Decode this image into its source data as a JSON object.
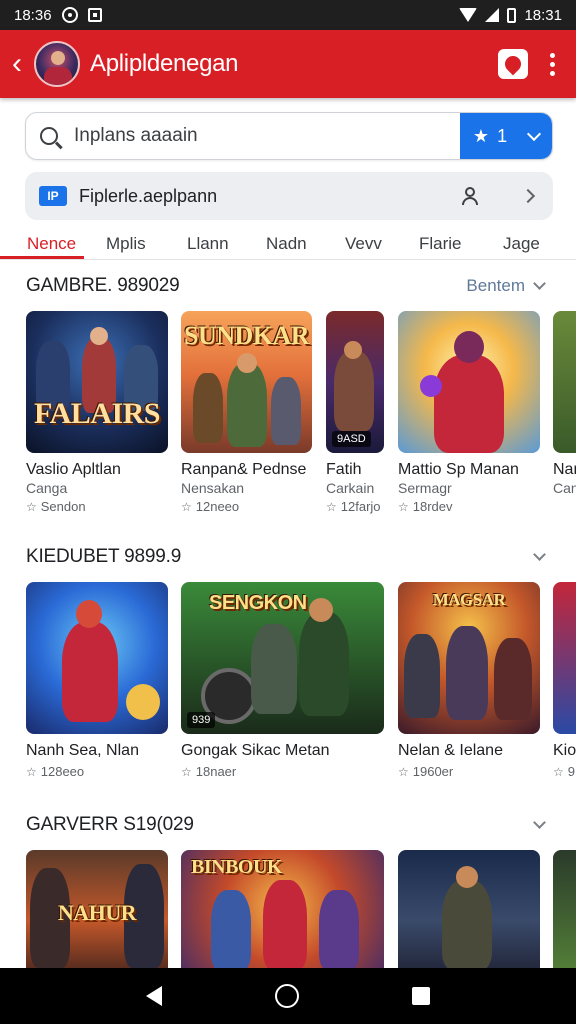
{
  "status_bar": {
    "time_left": "18:36",
    "time_right": "18:31"
  },
  "app_bar": {
    "title": "Aplipldenegan"
  },
  "search": {
    "placeholder": "Inplans aaaain",
    "value": "Inplans aaaain",
    "chip_label": "1"
  },
  "filter": {
    "label": "Fiplerle.aeplpann",
    "icon_text": "IP"
  },
  "tabs": [
    {
      "label": "Nence",
      "active": true
    },
    {
      "label": "Mplis"
    },
    {
      "label": "Llann"
    },
    {
      "label": "Nadn"
    },
    {
      "label": "Vevv"
    },
    {
      "label": "Flarie"
    },
    {
      "label": "Jage"
    }
  ],
  "sections": [
    {
      "title": "GAMBRE. 989029",
      "action": "Bentem",
      "cards": [
        {
          "thumb_text": "FALAIRS",
          "name": "Vaslio Apltlan",
          "sub": "Canga",
          "meta": "Sendon"
        },
        {
          "thumb_text": "SUNDKAR",
          "name": "Ranpan& Pednse",
          "sub": "Nensakan",
          "meta": "12neeo"
        },
        {
          "thumb_text": "",
          "badge": "9ASD",
          "name": "Fatih",
          "sub": "Carkain",
          "meta": "12farjo"
        },
        {
          "thumb_text": "",
          "name": "Mattio Sp Manan",
          "sub": "Sermagr",
          "meta": "18rdev"
        },
        {
          "thumb_text": "",
          "name": "Nan",
          "sub": "Can",
          "meta": ""
        }
      ]
    },
    {
      "title": "KIEDUBET 9899.9",
      "action": "",
      "cards": [
        {
          "thumb_text": "",
          "name": "Nanh Sea, Nlan",
          "sub": "",
          "meta": "128eeo"
        },
        {
          "thumb_text": "SENGKON",
          "badge": "939",
          "name": "Gongak Sikac Metan",
          "sub": "",
          "meta": "18naer"
        },
        {
          "thumb_text": "MAGSAR",
          "name": "Nelan & Ielane",
          "sub": "",
          "meta": "1960er"
        },
        {
          "thumb_text": "",
          "name": "Kio",
          "sub": "",
          "meta": "9"
        }
      ]
    },
    {
      "title": "GARVERR S19(029",
      "action": "",
      "cards": [
        {
          "thumb_text": "NAHUR",
          "name": "",
          "sub": "",
          "meta": ""
        },
        {
          "thumb_text": "BINBOUK",
          "name": "",
          "sub": "",
          "meta": ""
        },
        {
          "thumb_text": "",
          "name": "",
          "sub": "",
          "meta": ""
        },
        {
          "thumb_text": "",
          "name": "",
          "sub": "",
          "meta": ""
        }
      ]
    }
  ],
  "colors": {
    "app_bar": "#d81f26",
    "accent_blue": "#1a73e8",
    "tab_active": "#d81f26"
  },
  "icons": [
    "back-icon",
    "app-avatar",
    "appbar-action-icon",
    "more-icon",
    "search-icon",
    "star-icon",
    "chevron-down-icon",
    "filter-icon",
    "person-icon",
    "chevron-right-icon",
    "nav-back-icon",
    "nav-home-icon",
    "nav-recents-icon"
  ]
}
